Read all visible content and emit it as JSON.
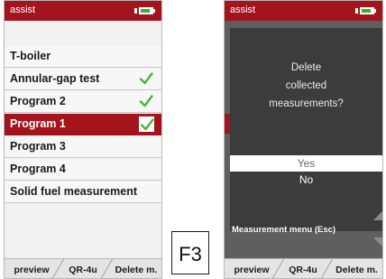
{
  "colors": {
    "brand_red": "#a4141c",
    "check_green": "#4bb43a",
    "battery_green": "#2fb23a",
    "dialog_bg": "#3c3c3c"
  },
  "left_screen": {
    "app_name": "assist",
    "battery_level": 0.7,
    "menu_items": [
      {
        "label": "T-boiler",
        "checked": false,
        "selected": false
      },
      {
        "label": "Annular-gap test",
        "checked": true,
        "selected": false
      },
      {
        "label": "Program 2",
        "checked": true,
        "selected": false
      },
      {
        "label": "Program 1",
        "checked": true,
        "selected": true
      },
      {
        "label": "Program 3",
        "checked": false,
        "selected": false
      },
      {
        "label": "Program 4",
        "checked": false,
        "selected": false
      },
      {
        "label": "Solid fuel measurement",
        "checked": false,
        "selected": false
      }
    ],
    "softkeys": [
      "preview",
      "QR-4u",
      "Delete m."
    ]
  },
  "key_label": "F3",
  "right_screen": {
    "app_name": "assist",
    "battery_level": 0.7,
    "dialog": {
      "lines": [
        "Delete",
        "collected",
        "measurements?"
      ],
      "options": [
        "Yes",
        "No"
      ],
      "selected_option": "Yes",
      "esc_label": "Measurement menu (Esc)"
    },
    "softkeys": [
      "preview",
      "QR-4u",
      "Delete m."
    ]
  }
}
